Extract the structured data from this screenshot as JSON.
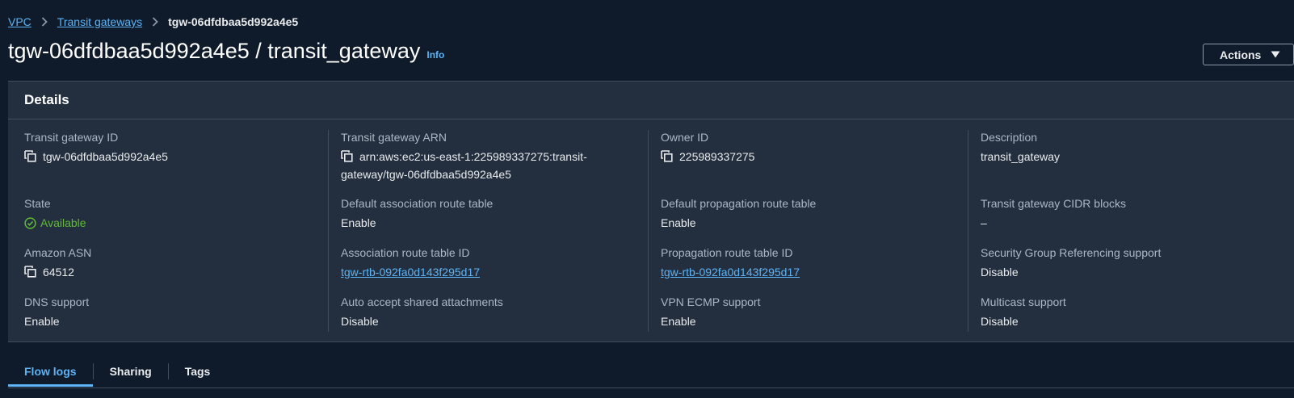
{
  "breadcrumb": {
    "items": [
      "VPC",
      "Transit gateways"
    ],
    "current": "tgw-06dfdbaa5d992a4e5"
  },
  "header": {
    "title": "tgw-06dfdbaa5d992a4e5 / transit_gateway",
    "info": "Info",
    "actions_label": "Actions"
  },
  "details": {
    "title": "Details",
    "transit_gateway_id": {
      "label": "Transit gateway ID",
      "value": "tgw-06dfdbaa5d992a4e5"
    },
    "transit_gateway_arn": {
      "label": "Transit gateway ARN",
      "value_line1": "arn:aws:ec2:us-east-1:225989337275:transit-",
      "value_line2": "gateway/tgw-06dfdbaa5d992a4e5"
    },
    "owner_id": {
      "label": "Owner ID",
      "value": "225989337275"
    },
    "description": {
      "label": "Description",
      "value": "transit_gateway"
    },
    "state": {
      "label": "State",
      "value": "Available"
    },
    "default_association_route_table": {
      "label": "Default association route table",
      "value": "Enable"
    },
    "default_propagation_route_table": {
      "label": "Default propagation route table",
      "value": "Enable"
    },
    "cidr_blocks": {
      "label": "Transit gateway CIDR blocks",
      "value": "–"
    },
    "amazon_asn": {
      "label": "Amazon ASN",
      "value": "64512"
    },
    "association_route_table_id": {
      "label": "Association route table ID",
      "value": "tgw-rtb-092fa0d143f295d17"
    },
    "propagation_route_table_id": {
      "label": "Propagation route table ID",
      "value": "tgw-rtb-092fa0d143f295d17"
    },
    "security_group_referencing": {
      "label": "Security Group Referencing support",
      "value": "Disable"
    },
    "dns_support": {
      "label": "DNS support",
      "value": "Enable"
    },
    "auto_accept": {
      "label": "Auto accept shared attachments",
      "value": "Disable"
    },
    "vpn_ecmp": {
      "label": "VPN ECMP support",
      "value": "Enable"
    },
    "multicast": {
      "label": "Multicast support",
      "value": "Disable"
    }
  },
  "tabs": [
    "Flow logs",
    "Sharing",
    "Tags"
  ],
  "colors": {
    "background": "#0f1b2a",
    "panel": "#232f3e",
    "link": "#5eb3f5",
    "success": "#5fbd33"
  },
  "icons": {
    "copy": "copy-icon",
    "status": "check-circle-icon",
    "breadcrumb_separator": "chevron-right-icon",
    "actions_caret": "caret-down-icon"
  }
}
